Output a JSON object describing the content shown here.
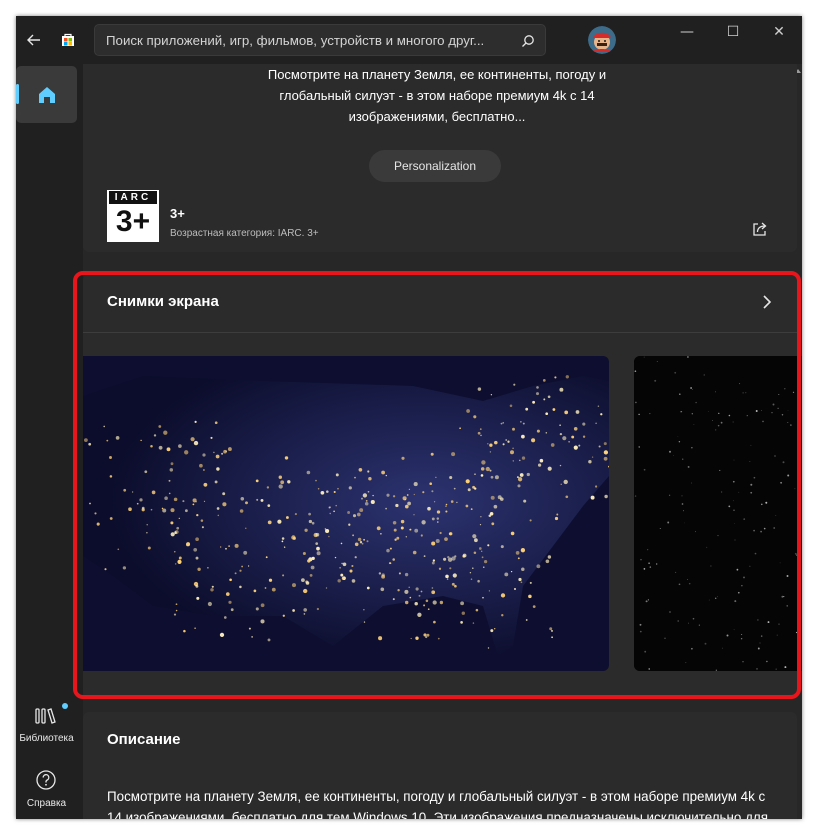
{
  "window": {
    "search": {
      "placeholder": "Поиск приложений, игр, фильмов, устройств и многого друг..."
    },
    "controls": {
      "minimize": "—",
      "maximize": "☐",
      "close": "✕"
    }
  },
  "sidebar": {
    "library_label": "Библиотека",
    "help_label": "Справка"
  },
  "app": {
    "short_description": "Посмотрите на планету Земля, ее континенты, погоду и глобальный силуэт - в этом наборе премиум 4k с 14 изображениями, бесплатно...",
    "category_chip": "Personalization",
    "rating": {
      "iarc_text": "IARC",
      "age": "3+",
      "value": "3+",
      "description": "Возрастная категория: IARC. 3+"
    },
    "screenshots_title": "Снимки экрана",
    "description_title": "Описание",
    "description_text": "Посмотрите на планету Земля, ее континенты, погоду и глобальный силуэт - в этом наборе премиум 4k с 14 изображениями, бесплатно для тем Windows 10. Эти изображения предназначены исключительно для использования в качестве обоев рабочего стола."
  },
  "colors": {
    "accent": "#60cdff",
    "highlight": "#e8161c",
    "background": "#272727",
    "card": "#2b2b2b"
  }
}
